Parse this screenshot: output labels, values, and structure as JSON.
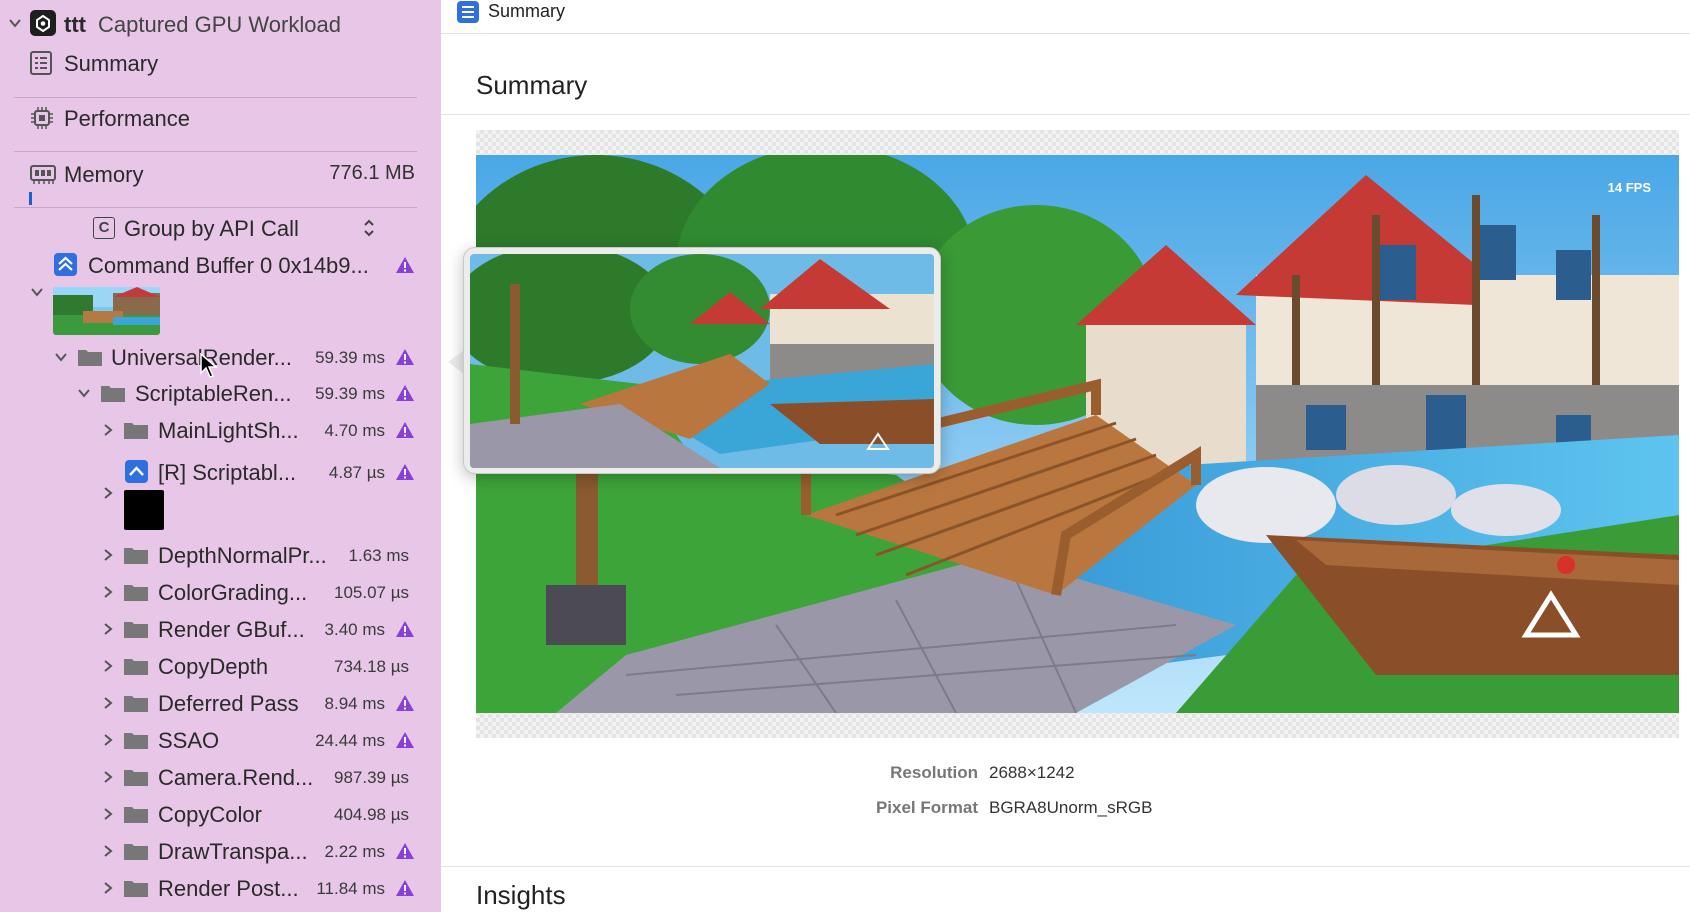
{
  "sidebar": {
    "workload": {
      "prefix": "ttt",
      "title": "Captured GPU Workload"
    },
    "summary_label": "Summary",
    "performance_label": "Performance",
    "memory": {
      "label": "Memory",
      "value": "776.1 MB"
    },
    "group_by": {
      "label": "Group by API Call"
    },
    "command_buffer": {
      "label": "Command Buffer 0 0x14b9..."
    },
    "tree": [
      {
        "label": "UniversalRender...",
        "time": "59.39 ms",
        "warn": true
      },
      {
        "label": "ScriptableRen...",
        "time": "59.39 ms",
        "warn": true
      },
      {
        "label": "MainLightSh...",
        "time": "4.70 ms",
        "warn": true
      },
      {
        "label": "[R] Scriptabl...",
        "time": "4.87 µs",
        "warn": true
      },
      {
        "label": "DepthNormalPr...",
        "time": "1.63 ms",
        "warn": false
      },
      {
        "label": "ColorGrading...",
        "time": "105.07 µs",
        "warn": false
      },
      {
        "label": "Render GBuf...",
        "time": "3.40 ms",
        "warn": true
      },
      {
        "label": "CopyDepth",
        "time": "734.18 µs",
        "warn": false
      },
      {
        "label": "Deferred Pass",
        "time": "8.94 ms",
        "warn": true
      },
      {
        "label": "SSAO",
        "time": "24.44 ms",
        "warn": true
      },
      {
        "label": "Camera.Rend...",
        "time": "987.39 µs",
        "warn": false
      },
      {
        "label": "CopyColor",
        "time": "404.98 µs",
        "warn": false
      },
      {
        "label": "DrawTranspa...",
        "time": "2.22 ms",
        "warn": true
      },
      {
        "label": "Render Post...",
        "time": "11.84 ms",
        "warn": true
      }
    ]
  },
  "main": {
    "tab_title": "Summary",
    "summary_heading": "Summary",
    "fps_overlay": "14 FPS",
    "resolution": {
      "key": "Resolution",
      "value": "2688×1242"
    },
    "pixel_format": {
      "key": "Pixel Format",
      "value": "BGRA8Unorm_sRGB"
    },
    "insights_heading": "Insights"
  },
  "colors": {
    "sidebar_bg": "#e8c6e8",
    "warning": "#8a3fd6",
    "accent": "#2f6fe0"
  },
  "icons": [
    "chevron-down-icon",
    "chevron-right-icon",
    "app-icon",
    "list-icon",
    "chip-icon",
    "memory-icon",
    "group-icon",
    "command-buffer-icon",
    "folder-icon",
    "warning-icon",
    "pointer-icon"
  ]
}
